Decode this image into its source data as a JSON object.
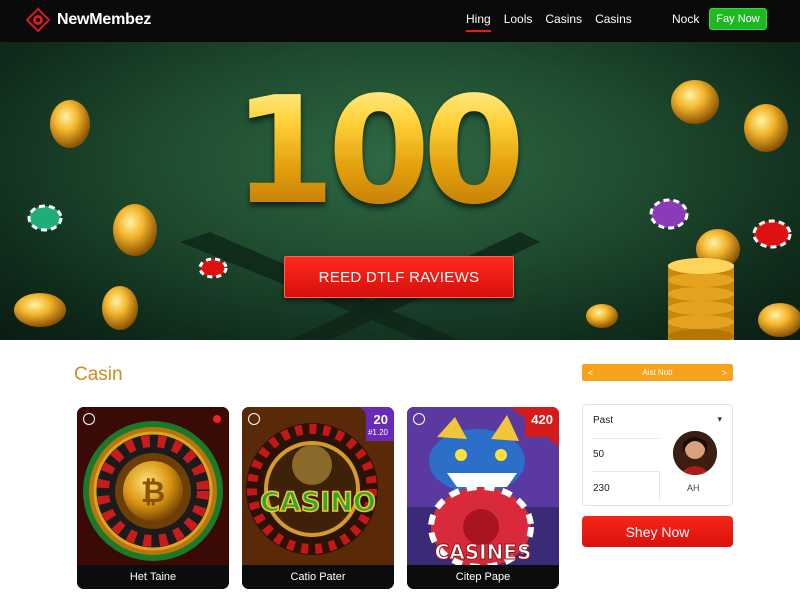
{
  "nav": {
    "brand": "NewMembez",
    "links": [
      "Hing",
      "Lools",
      "Casins",
      "Casins"
    ],
    "login_label": "Nock",
    "cta_label": "Fay Now"
  },
  "hero": {
    "title": "100",
    "button_label": "REED DTLF RAVIEWS"
  },
  "section": {
    "title": "Casin"
  },
  "filter": {
    "left_arrow": "<",
    "label": "Aist Nott",
    "right_arrow": ">"
  },
  "cards": [
    {
      "title": "Het Taine",
      "badge": "",
      "badge_sub": ""
    },
    {
      "title": "Catio Pater",
      "badge": "20",
      "badge_sub": "#1.20",
      "image_text": "CASINO"
    },
    {
      "title": "Citep Pape",
      "badge": "420",
      "badge_sub": "",
      "image_text": "CASINES"
    }
  ],
  "panel": {
    "label": "Past",
    "row1": "50",
    "row2": "230",
    "avatar_caption": "AH"
  },
  "shop_button": {
    "label": "Shey Now"
  },
  "colors": {
    "nav_bg": "#0a0a0a",
    "brand_red": "#e01e1e",
    "cta_green": "#1fb722",
    "accent_orange": "#f6a21b",
    "hero_gold": "#f3b61a",
    "button_red": "#e0150f"
  }
}
